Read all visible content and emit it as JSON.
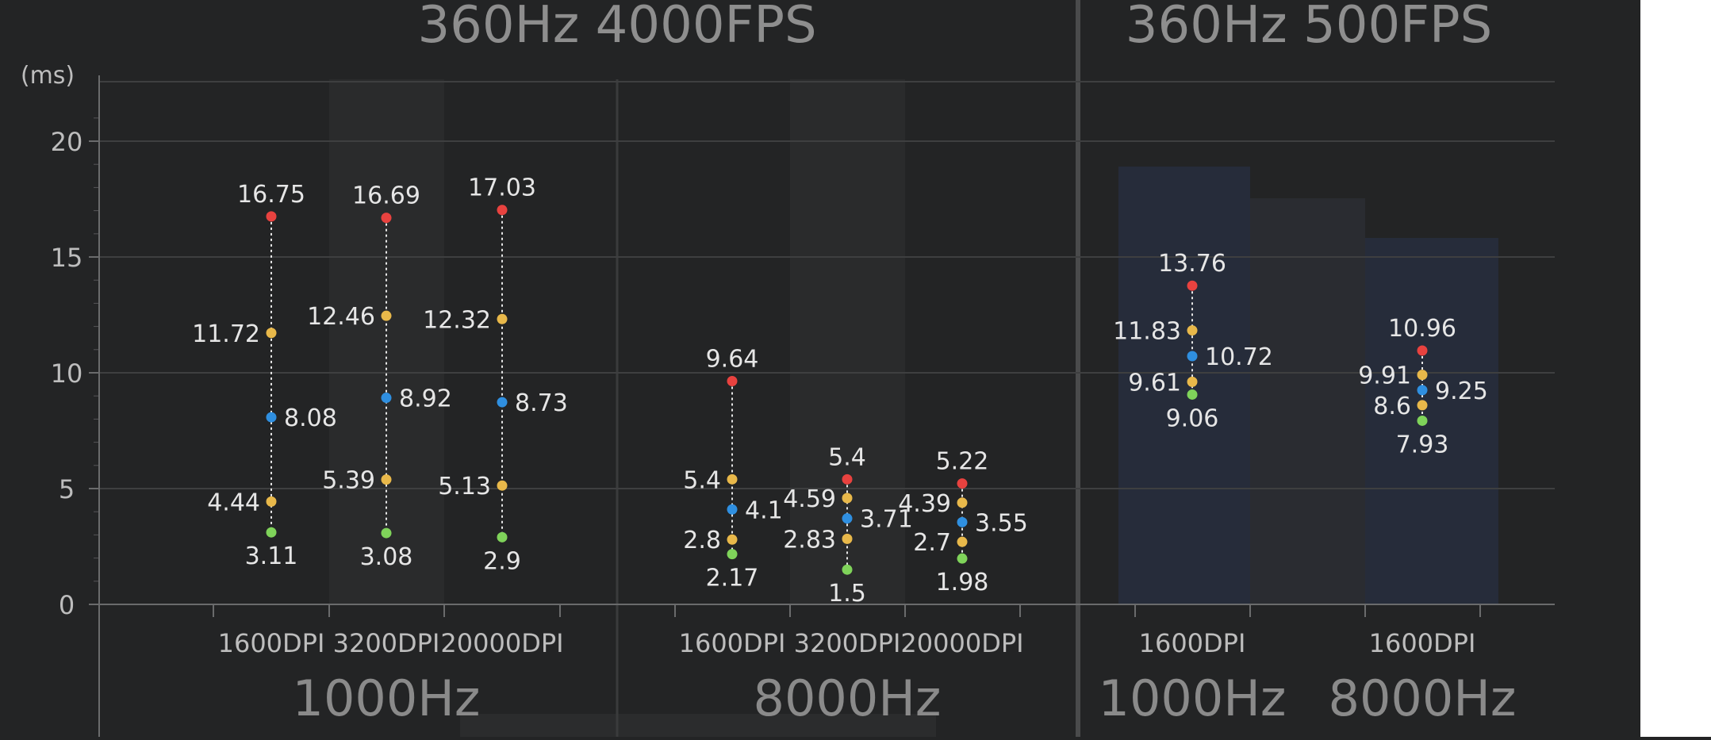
{
  "headings": {
    "left": "360Hz 4000FPS",
    "right": "360Hz 500FPS"
  },
  "axis": {
    "unit": "(ms)",
    "ticks": [
      "0",
      "5",
      "10",
      "15",
      "20"
    ]
  },
  "colors": {
    "background": "#232425",
    "max": "#e8423f",
    "upper": "#e8b84a",
    "mid": "#2f8fe0",
    "lower": "#e8b84a",
    "min": "#7fd35a",
    "text": "#e6e6e6",
    "heading": "#8e8e8e"
  },
  "chart_data": {
    "type": "scatter",
    "ylabel": "(ms)",
    "ylim": [
      0,
      22
    ],
    "yticks": [
      0,
      5,
      10,
      15,
      20
    ],
    "series_roles": [
      "max",
      "upper",
      "mid",
      "lower",
      "min"
    ],
    "groups": [
      {
        "heading": "360Hz 4000FPS",
        "subgroups": [
          {
            "label": "1000Hz",
            "categories": [
              {
                "label": "1600DPI",
                "values": {
                  "max": 16.75,
                  "upper": 11.72,
                  "mid": 8.08,
                  "lower": 4.44,
                  "min": 3.11
                },
                "labels": {
                  "max": "16.75",
                  "upper": "11.72",
                  "mid": "8.08",
                  "lower": "4.44",
                  "min": "3.11"
                }
              },
              {
                "label": "3200DPI",
                "values": {
                  "max": 16.69,
                  "upper": 12.46,
                  "mid": 8.92,
                  "lower": 5.39,
                  "min": 3.08
                },
                "labels": {
                  "max": "16.69",
                  "upper": "12.46",
                  "mid": "8.92",
                  "lower": "5.39",
                  "min": "3.08"
                }
              },
              {
                "label": "20000DPI",
                "values": {
                  "max": 17.03,
                  "upper": 12.32,
                  "mid": 8.73,
                  "lower": 5.13,
                  "min": 2.9
                },
                "labels": {
                  "max": "17.03",
                  "upper": "12.32",
                  "mid": "8.73",
                  "lower": "5.13",
                  "min": "2.9"
                }
              }
            ]
          },
          {
            "label": "8000Hz",
            "categories": [
              {
                "label": "1600DPI",
                "values": {
                  "max": 9.64,
                  "upper": 5.4,
                  "mid": 4.1,
                  "lower": 2.8,
                  "min": 2.17
                },
                "labels": {
                  "max": "9.64",
                  "upper": "5.4",
                  "mid": "4.1",
                  "lower": "2.8",
                  "min": "2.17"
                }
              },
              {
                "label": "3200DPI",
                "values": {
                  "max": 5.4,
                  "upper": 4.59,
                  "mid": 3.71,
                  "lower": 2.83,
                  "min": 1.5
                },
                "labels": {
                  "max": "5.4",
                  "upper": "4.59",
                  "mid": "3.71",
                  "lower": "2.83",
                  "min": "1.5"
                }
              },
              {
                "label": "20000DPI",
                "values": {
                  "max": 5.22,
                  "upper": 4.39,
                  "mid": 3.55,
                  "lower": 2.7,
                  "min": 1.98
                },
                "labels": {
                  "max": "5.22",
                  "upper": "4.39",
                  "mid": "3.55",
                  "lower": "2.7",
                  "min": "1.98"
                }
              }
            ]
          }
        ]
      },
      {
        "heading": "360Hz 500FPS",
        "subgroups": [
          {
            "label": "1000Hz",
            "categories": [
              {
                "label": "1600DPI",
                "values": {
                  "max": 13.76,
                  "upper": 11.83,
                  "mid": 10.72,
                  "lower": 9.61,
                  "min": 9.06
                },
                "labels": {
                  "max": "13.76",
                  "upper": "11.83",
                  "mid": "10.72",
                  "lower": "9.61",
                  "min": "9.06"
                }
              }
            ]
          },
          {
            "label": "8000Hz",
            "categories": [
              {
                "label": "1600DPI",
                "values": {
                  "max": 10.96,
                  "upper": 9.91,
                  "mid": 9.25,
                  "lower": 8.6,
                  "min": 7.93
                },
                "labels": {
                  "max": "10.96",
                  "upper": "9.91",
                  "mid": "9.25",
                  "lower": "8.6",
                  "min": "7.93"
                }
              }
            ]
          }
        ]
      }
    ]
  }
}
